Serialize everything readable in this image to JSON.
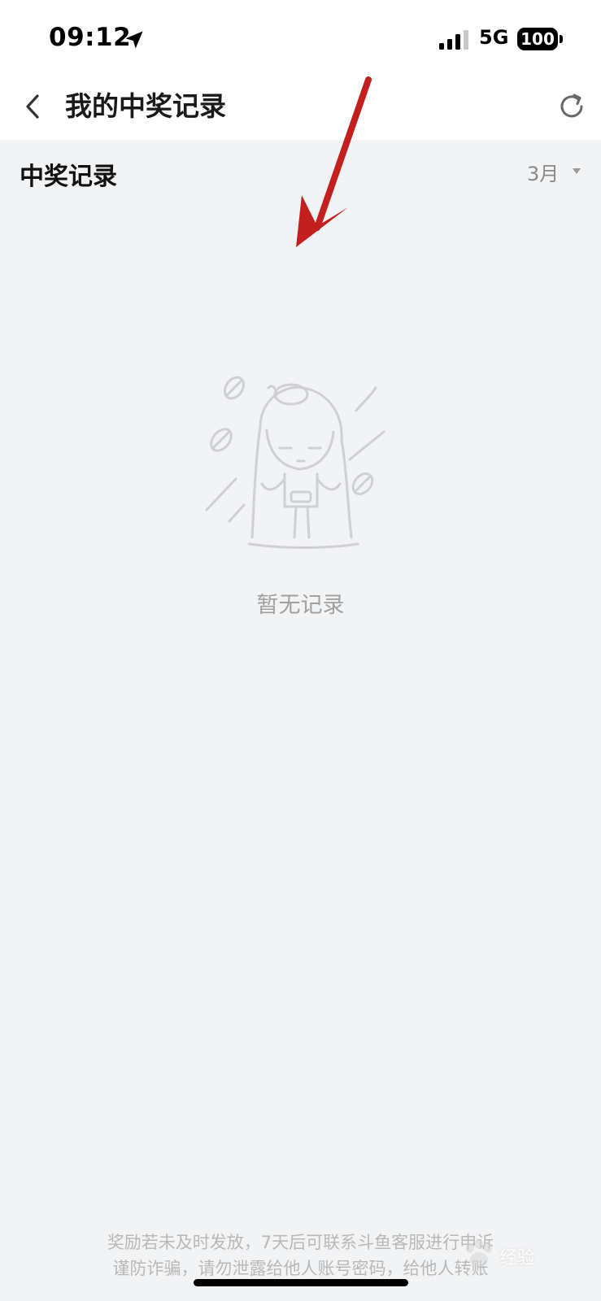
{
  "status_bar": {
    "time": "09:12",
    "network": "5G",
    "battery": "100",
    "icons": [
      "location-arrow-icon",
      "signal-bars-icon",
      "battery-icon"
    ]
  },
  "nav": {
    "title": "我的中奖记录",
    "back_icon": "chevron-left-icon",
    "refresh_icon": "refresh-icon"
  },
  "section": {
    "title": "中奖记录",
    "month": "3月",
    "caret_icon": "caret-down-icon"
  },
  "empty_state": {
    "illustration": "empty-character-illustration",
    "text": "暂无记录"
  },
  "footer": {
    "line1": "奖励若未及时发放，7天后可联系斗鱼客服进行申诉",
    "line2": "谨防诈骗，请勿泄露给他人账号密码，给他人转账"
  },
  "watermark": {
    "text": "经验"
  },
  "colors": {
    "background": "#f2f3f5",
    "annotation_arrow": "#c41f1f",
    "muted_text": "#a0a0a0"
  }
}
